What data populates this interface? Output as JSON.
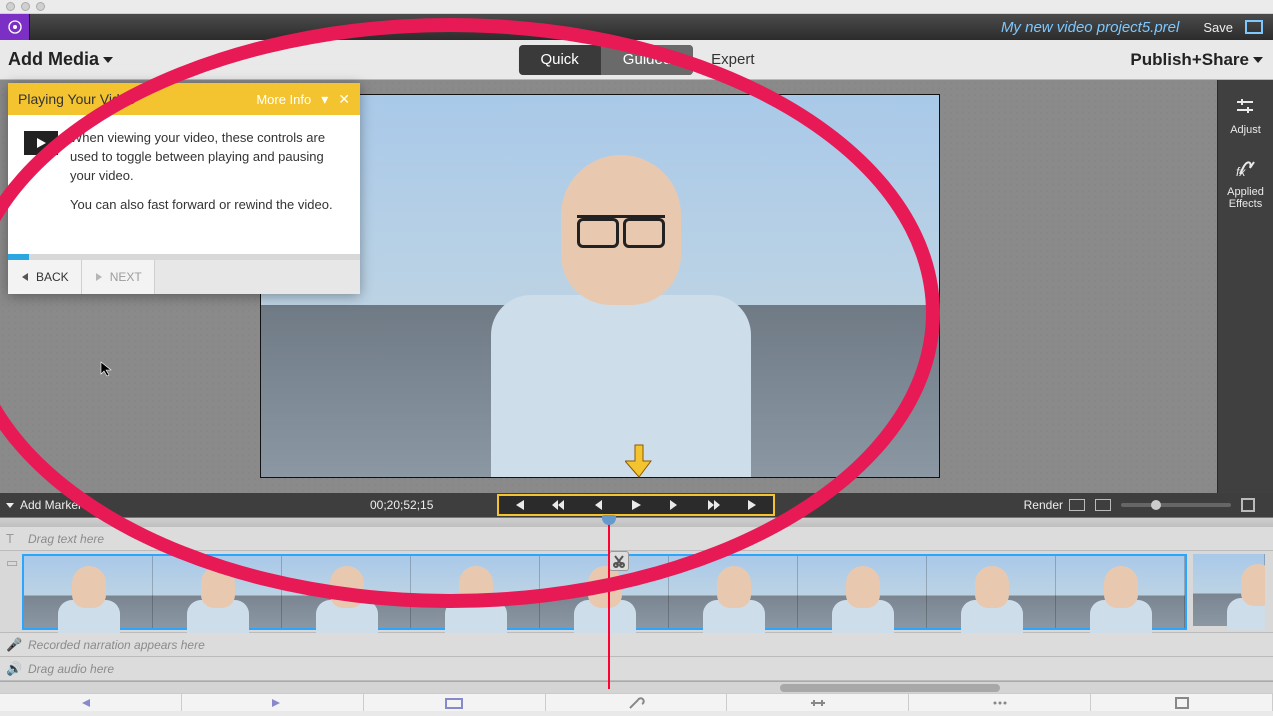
{
  "topbar": {
    "project_name": "My new video project5.prel",
    "save_label": "Save"
  },
  "mode_row": {
    "add_media_label": "Add Media",
    "tab_quick": "Quick",
    "tab_guided": "Guided",
    "tab_expert": "Expert",
    "publish_label": "Publish+Share"
  },
  "side_panel": {
    "adjust_label": "Adjust",
    "effects_label": "Applied Effects"
  },
  "guide": {
    "title": "Playing Your Video",
    "more_info": "More Info",
    "body_line1": "When viewing your video, these controls are used to toggle between playing and pausing your video.",
    "body_line2": "You can also fast forward or rewind the video.",
    "back_label": "BACK",
    "next_label": "NEXT"
  },
  "transport": {
    "add_marker_label": "Add Marker",
    "timecode": "00;20;52;15",
    "render_label": "Render"
  },
  "tracks": {
    "text_placeholder": "Drag text here",
    "narration_placeholder": "Recorded narration appears here",
    "audio_placeholder": "Drag audio here"
  }
}
